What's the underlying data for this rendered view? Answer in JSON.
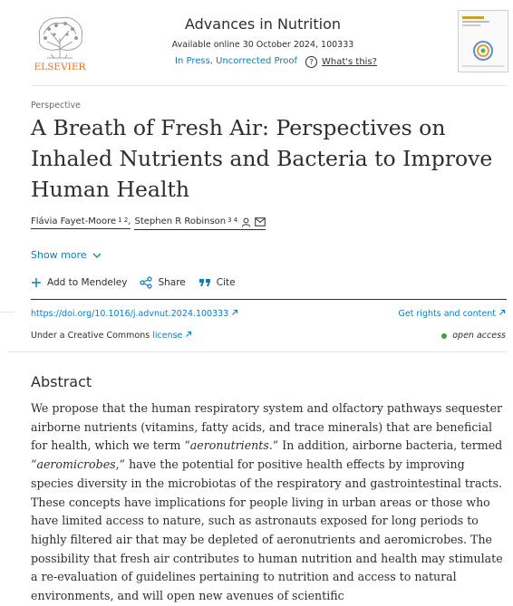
{
  "header": {
    "publisher": "ELSEVIER",
    "journal_title": "Advances in Nutrition",
    "available": "Available online 30 October 2024, 100333",
    "in_press": "In Press, Uncorrected Proof",
    "whats_this": "What's this?"
  },
  "article": {
    "type": "Perspective",
    "title": "A Breath of Fresh Air: Perspectives on Inhaled Nutrients and Bacteria to Improve Human Health",
    "authors": [
      {
        "name": "Flávia Fayet-Moore",
        "sup": "1 2"
      },
      {
        "name": "Stephen R Robinson",
        "sup": "3 4"
      }
    ],
    "author_separator": ",",
    "show_more": "Show more"
  },
  "actions": {
    "mendeley": "Add to Mendeley",
    "share": "Share",
    "cite": "Cite"
  },
  "links": {
    "doi": "https://doi.org/10.1016/j.advnut.2024.100333",
    "rights": "Get rights and content",
    "license_prefix": "Under a Creative Commons",
    "license_link": "license",
    "open_access": "open access"
  },
  "abstract": {
    "heading": "Abstract",
    "text_1": "We propose that the human respiratory system and olfactory pathways sequester airborne nutrients (vitamins, fatty acids, and trace minerals) that are beneficial for health, which we term “",
    "term_1": "aeronutrients",
    "text_2": ".” In addition, airborne bacteria, termed “",
    "term_2": "aeromicrobes",
    "text_3": ",” have the potential for positive health effects by improving species diversity in the microbiotas of the respiratory and gastrointestinal tracts. These concepts have implications for people living in urban areas or those who have limited access to nature, such as astronauts exposed for long periods to highly filtered air that may be depleted of aeronutrients and aeromicrobes. The possibility that fresh air contributes to human nutrition and health may stimulate a re-evaluation of guidelines pertaining to nutrition and access to natural environments, and will open new avenues of scientific"
  },
  "colors": {
    "link": "#0c7dbb",
    "text": "#2e2e2e",
    "publisher_orange": "#e9711c",
    "open_access_dot": "#3aa34a"
  }
}
